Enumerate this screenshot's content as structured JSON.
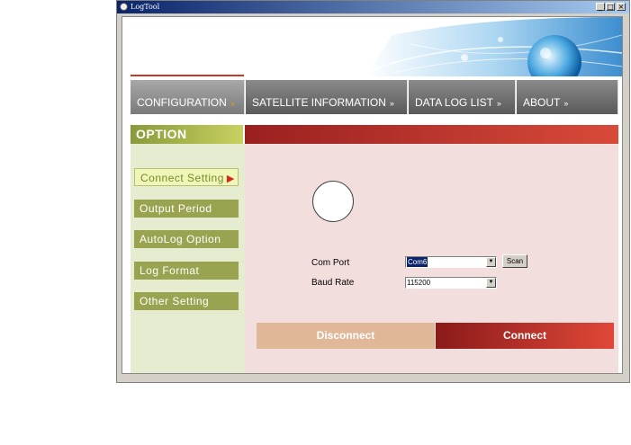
{
  "window": {
    "title": "LogTool",
    "minimize_glyph": "_",
    "maximize_glyph": "□",
    "close_glyph": "×"
  },
  "tabs": [
    {
      "label": "CONFIGURATION",
      "arrow": "»",
      "active": true
    },
    {
      "label": "SATELLITE  INFORMATION",
      "arrow": "»",
      "active": false
    },
    {
      "label": "DATA  LOG  LIST",
      "arrow": "»",
      "active": false
    },
    {
      "label": "ABOUT",
      "arrow": "»",
      "active": false
    }
  ],
  "option_header": "OPTION",
  "sidebar": {
    "items": [
      {
        "label": "Connect  Setting",
        "active": true
      },
      {
        "label": "Output  Period",
        "active": false
      },
      {
        "label": "AutoLog  Option",
        "active": false
      },
      {
        "label": "Log  Format",
        "active": false
      },
      {
        "label": "Other  Setting",
        "active": false
      }
    ],
    "active_marker": "▶"
  },
  "connect_form": {
    "com_port_label": "Com Port",
    "com_port_value": "Com6",
    "baud_rate_label": "Baud Rate",
    "baud_rate_value": "115200",
    "scan_label": "Scan",
    "dropdown_glyph": "▼"
  },
  "buttons": {
    "disconnect": "Disconnect",
    "connect": "Connect"
  },
  "colors": {
    "accent_red": "#c8382a",
    "option_green": "#9aa450",
    "panel_pink": "#f3dede"
  }
}
